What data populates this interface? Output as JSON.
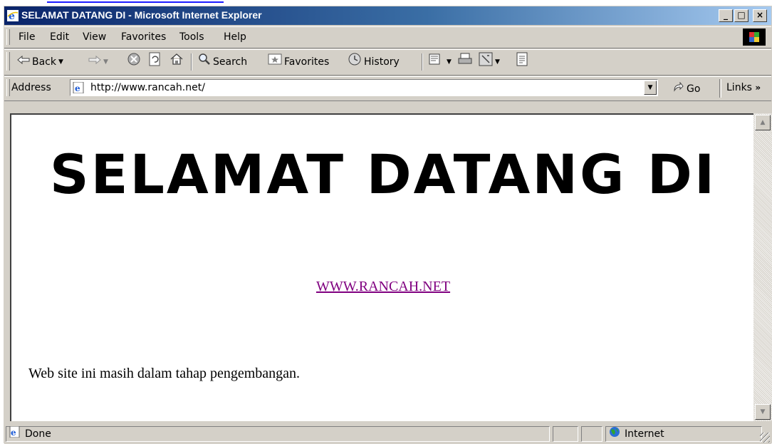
{
  "window": {
    "title": "SELAMAT DATANG DI - Microsoft Internet Explorer",
    "caption_buttons": {
      "minimize": "_",
      "maximize": "□",
      "close": "×"
    }
  },
  "menu": {
    "items": [
      {
        "label": "File"
      },
      {
        "label": "Edit"
      },
      {
        "label": "View"
      },
      {
        "label": "Favorites"
      },
      {
        "label": "Tools"
      },
      {
        "label": "Help"
      }
    ]
  },
  "toolbar": {
    "back_label": "Back",
    "search_label": "Search",
    "favorites_label": "Favorites",
    "history_label": "History",
    "icons": [
      "back-arrow-icon",
      "forward-arrow-icon",
      "stop-icon",
      "refresh-icon",
      "home-icon",
      "search-icon",
      "favorites-icon",
      "history-icon",
      "mail-icon",
      "print-icon",
      "edit-icon",
      "discuss-icon"
    ]
  },
  "address": {
    "label": "Address",
    "url": "http://www.rancah.net/",
    "go_label": "Go",
    "links_label": "Links"
  },
  "page": {
    "heading": "SELAMAT DATANG DI",
    "link_text": "WWW.RANCAH.NET",
    "body_text": "Web site ini masih dalam tahap pengembangan.",
    "link_color": "#800080"
  },
  "status": {
    "text": "Done",
    "zone": "Internet"
  },
  "colors": {
    "titlebar_start": "#0a246a",
    "titlebar_end": "#a6caf0",
    "chrome": "#d4d0c8"
  }
}
